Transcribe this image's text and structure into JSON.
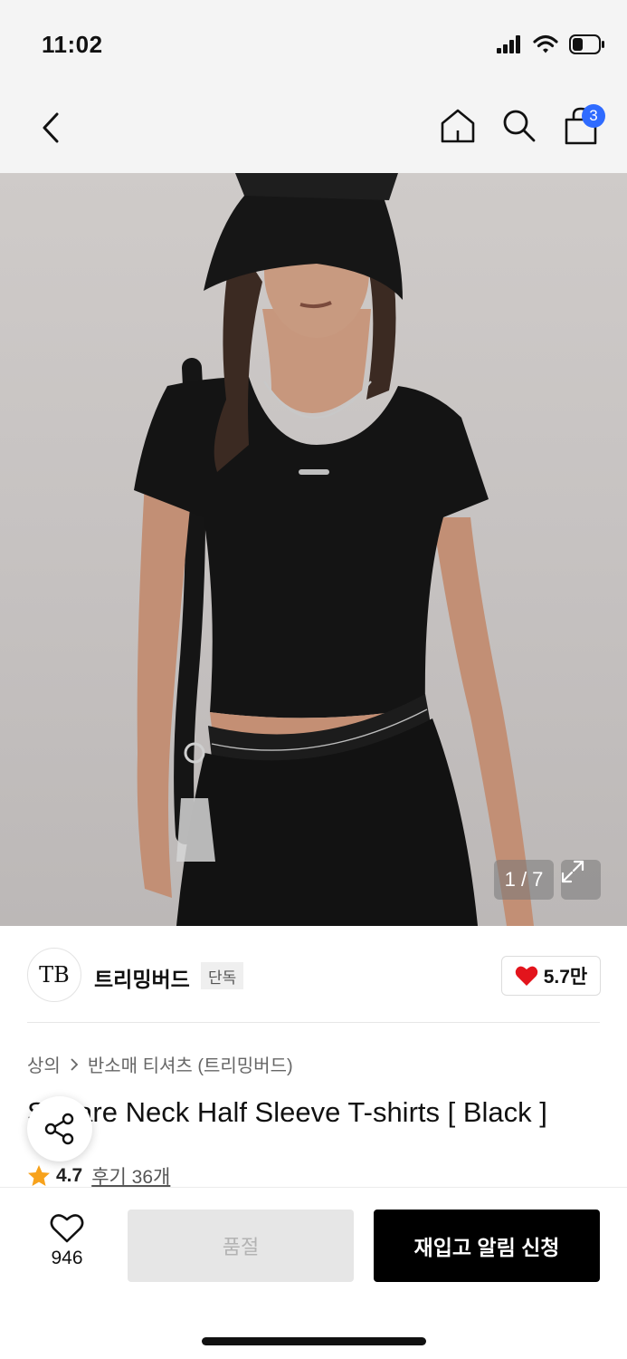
{
  "status_bar": {
    "time": "11:02"
  },
  "nav": {
    "cart_count": "3"
  },
  "hero": {
    "counter": "1 / 7"
  },
  "brand": {
    "name": "트리밍버드",
    "badge": "단독",
    "logo_text": "TB",
    "likes": "5.7만"
  },
  "breadcrumb": {
    "category": "상의",
    "subcategory": "반소매 티셔츠 (트리밍버드)"
  },
  "product": {
    "title": "Square Neck Half Sleeve T-shirts [ Black ]"
  },
  "rating": {
    "value": "4.7",
    "reviews": "후기 36개"
  },
  "bottom_bar": {
    "wish_count": "946",
    "sold_out_label": "품절",
    "restock_label": "재입고 알림 신청"
  },
  "colors": {
    "accent_blue": "#2f6bff",
    "heart_red": "#e3141c",
    "star": "#f7a21b",
    "primary_button": "#000000",
    "disabled_button": "#e6e6e6"
  },
  "icons": [
    "back-arrow-icon",
    "home-icon",
    "search-icon",
    "cart-icon",
    "expand-icon",
    "heart-icon",
    "share-icon",
    "star-icon"
  ]
}
